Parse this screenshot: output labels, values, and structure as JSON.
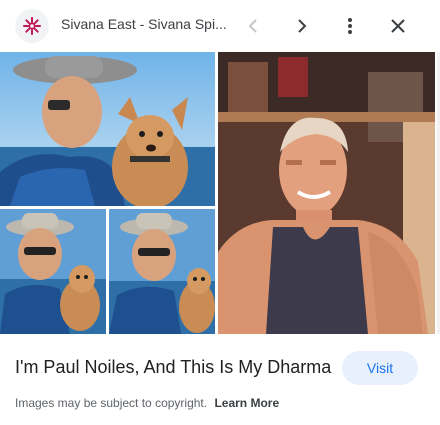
{
  "header": {
    "site_title": "Sivana East - Sivana Spi...",
    "logo_icon": "sivana-star-icon",
    "buttons": {
      "prev_icon": "chevron-left-icon",
      "next_icon": "chevron-right-icon",
      "more_icon": "more-vertical-icon",
      "close_icon": "close-icon"
    }
  },
  "images": [
    {
      "description_icon": "photo-man-hat-with-dog"
    },
    {
      "description_icon": "photo-man-gym-selfie"
    },
    {
      "description_icon": "photo-man-hat-dog-small-1"
    },
    {
      "description_icon": "photo-man-hat-dog-small-2"
    }
  ],
  "result": {
    "title": "I'm Paul Noiles, And This Is My Dharma",
    "visit_label": "Visit"
  },
  "footer": {
    "copyright_text": "Images may be subject to copyright.",
    "learn_more_label": "Learn More"
  },
  "colors": {
    "accent": "#1a73e8",
    "visit_bg": "#e8f0fe",
    "logo_color": "#c2185b"
  }
}
